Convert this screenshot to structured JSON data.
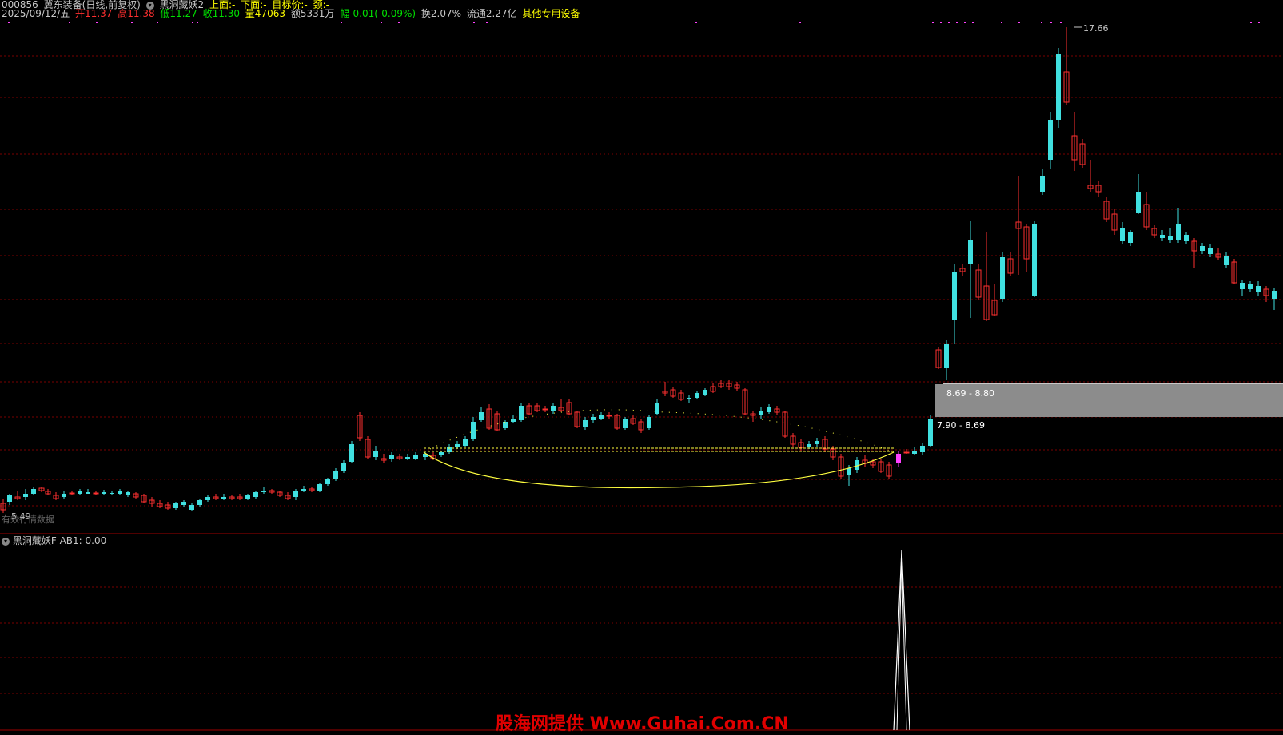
{
  "header": {
    "line1": [
      {
        "text": "000856",
        "color": "#c8c8c8"
      },
      {
        "text": "冀东装备(日线,前复权)",
        "color": "#c8c8c8"
      },
      {
        "text": "黑洞藏妖2",
        "color": "#c8c8c8",
        "icon": "circle-down-icon"
      },
      {
        "text": "上面:-",
        "color": "#ffff00"
      },
      {
        "text": "下面:-",
        "color": "#ffff00"
      },
      {
        "text": "目标价:-",
        "color": "#ffff00"
      },
      {
        "text": "颈:-",
        "color": "#ffff00"
      }
    ],
    "line2": [
      {
        "text": "2025/09/12/五",
        "color": "#c8c8c8"
      },
      {
        "text": "开11.37",
        "color": "#ff3030"
      },
      {
        "text": "高11.38",
        "color": "#ff3030"
      },
      {
        "text": "低11.27",
        "color": "#00e000"
      },
      {
        "text": "收11.30",
        "color": "#00e000"
      },
      {
        "text": "量47063",
        "color": "#ffff00"
      },
      {
        "text": "额5331万",
        "color": "#c8c8c8"
      },
      {
        "text": "幅-0.01(-0.09%)",
        "color": "#00e000"
      },
      {
        "text": "换2.07%",
        "color": "#c8c8c8"
      },
      {
        "text": "流通2.27亿",
        "color": "#c8c8c8"
      },
      {
        "text": "其他专用设备",
        "color": "#ffff00"
      }
    ]
  },
  "main_chart": {
    "high_label": "17.66",
    "low_label": "5.49",
    "no_data_text": "有效行情数据",
    "zone_upper_label": "8.69 - 8.80",
    "zone_lower_label": "7.90 - 8.69",
    "colors": {
      "up": "#ff3030",
      "down": "#40e0e0",
      "grid": "#7a0000",
      "zone": "#8c8c8c",
      "curve": "#ffff40",
      "marker": "#ff40ff"
    }
  },
  "sub_chart": {
    "title": "黑洞藏妖F",
    "value_label": "AB1: 0.00",
    "icon": "circle-down-icon"
  },
  "watermark": "股海网提供 Www.Guhai.Com.CN"
}
